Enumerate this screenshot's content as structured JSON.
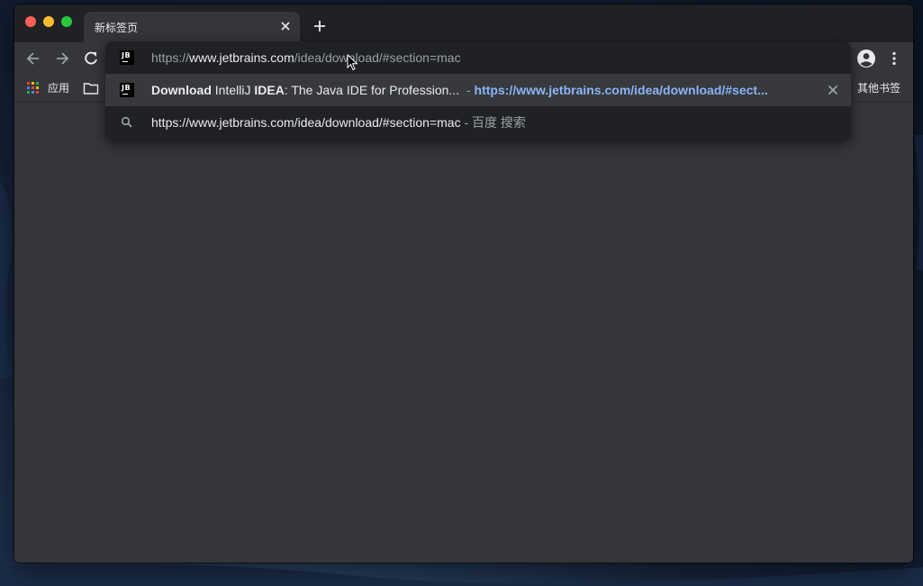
{
  "tab": {
    "title": "新标签页"
  },
  "bookmarks": {
    "apps_label": "应用",
    "other_label": "其他书签"
  },
  "omnibox": {
    "input_prefix": "https://",
    "input_host": "www.jetbrains.com",
    "input_path": "/idea/download/#section=mac",
    "suggestion": {
      "title_parts": [
        "Download",
        " IntelliJ ",
        "IDEA",
        ": The Java IDE for Profession..."
      ],
      "separator": " - ",
      "url": "https://www.jetbrains.com/idea/download/#sect..."
    },
    "search": {
      "query": "https://www.jetbrains.com/idea/download/#section=mac",
      "separator": " - ",
      "engine": "百度 搜索"
    },
    "favicon_text": "JB"
  },
  "colors": {
    "accent_link": "#8ab4f8",
    "frame": "#202124",
    "toolbar": "#35363a"
  }
}
